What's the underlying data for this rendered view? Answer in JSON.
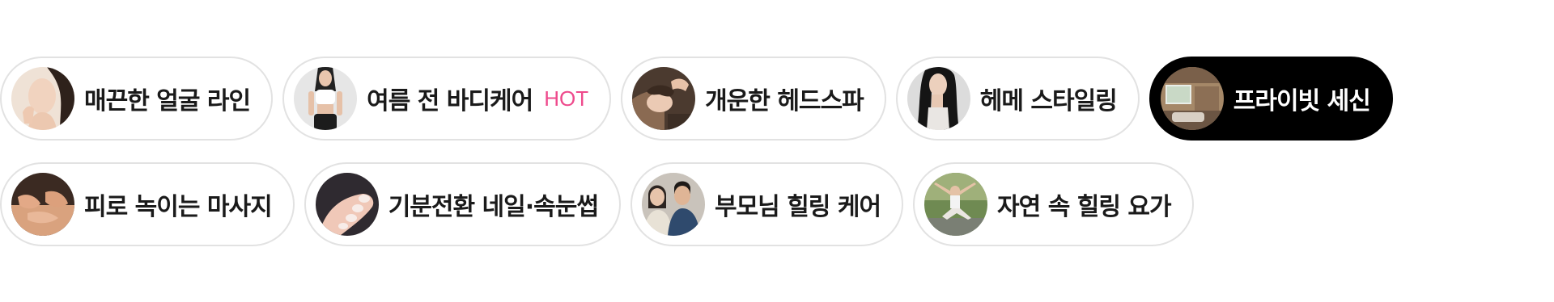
{
  "categories": {
    "selected_index": 4,
    "chips": [
      {
        "label": "매끈한 얼굴 라인",
        "thumbnail": "face-line-photo",
        "badge": ""
      },
      {
        "label": "여름 전 바디케어",
        "thumbnail": "body-care-photo",
        "badge": "HOT",
        "badge_color": "#ee4a8c"
      },
      {
        "label": "개운한 헤드스파",
        "thumbnail": "head-spa-photo",
        "badge": ""
      },
      {
        "label": "헤메 스타일링",
        "thumbnail": "hair-makeup-photo",
        "badge": ""
      },
      {
        "label": "프라이빗 세신",
        "thumbnail": "private-bath-photo",
        "badge": "",
        "selected": true
      },
      {
        "label": "피로 녹이는 마사지",
        "thumbnail": "massage-photo",
        "badge": ""
      },
      {
        "label": "기분전환 네일·속눈썹",
        "thumbnail": "nail-lash-photo",
        "badge": ""
      },
      {
        "label": "부모님 힐링 케어",
        "thumbnail": "parents-care-photo",
        "badge": ""
      },
      {
        "label": "자연 속 힐링 요가",
        "thumbnail": "yoga-photo",
        "badge": ""
      }
    ]
  },
  "colors": {
    "selected_background": "#000000",
    "chip_border": "#e2e2e2",
    "hot_badge": "#ee4a8c"
  }
}
